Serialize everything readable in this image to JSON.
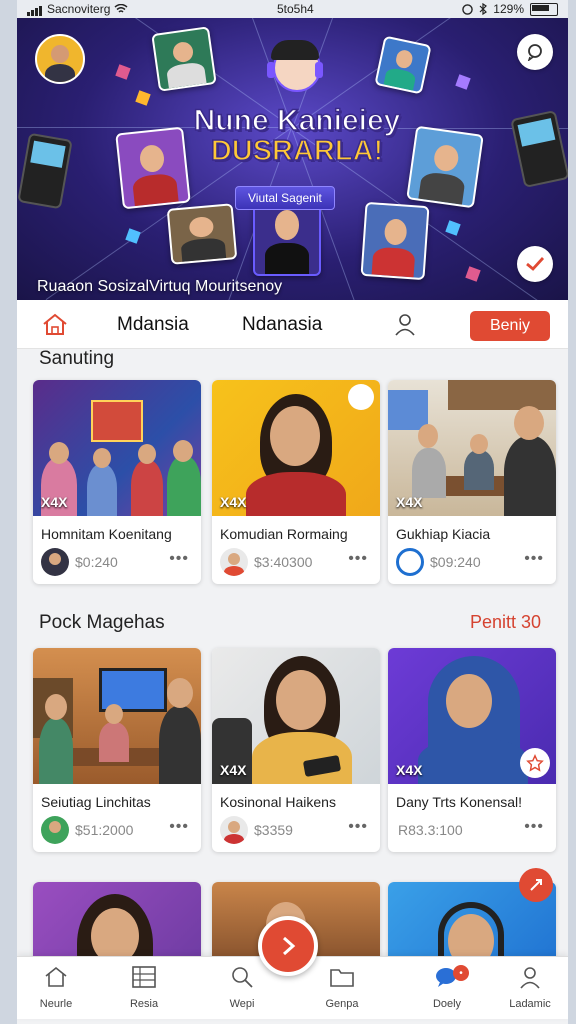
{
  "status_bar": {
    "carrier": "Sacnoviterg",
    "time": "5to5h4",
    "battery": "129%"
  },
  "hero": {
    "title_line1": "Nune Kanieiey",
    "title_line2": "DUSRARLA!",
    "pill": "Viutal Sagenit",
    "caption": "Ruaaon SosizalVirtuq Mouritsenoy"
  },
  "navbar": {
    "tab1": "Mdansia",
    "tab2": "Ndanasia",
    "button": "Beniy"
  },
  "section1": {
    "title": "Sanuting",
    "cards": [
      {
        "title": "Homnitam Koenitang",
        "price": "$0:240",
        "tag": "X4X"
      },
      {
        "title": "Komudian Rormaing",
        "price": "$3:40300",
        "tag": "X4X"
      },
      {
        "title": "Gukhiap Kiacia",
        "price": "$09:240",
        "tag": "X4X"
      }
    ]
  },
  "section2": {
    "title": "Pock Magehas",
    "link": "Penitt 30",
    "cards": [
      {
        "title": "Seiutiag Linchitas",
        "price": "$51:2000",
        "tag": ""
      },
      {
        "title": "Kosinonal Haikens",
        "price": "$3359",
        "tag": "X4X"
      },
      {
        "title": "Dany Trts Konensal!",
        "price": "R83.3:100",
        "tag": "X4X"
      }
    ]
  },
  "tabbar": {
    "items": [
      {
        "label": "Neurle",
        "icon": "home-icon"
      },
      {
        "label": "Resia",
        "icon": "grid-icon"
      },
      {
        "label": "Wepi",
        "icon": "search-icon"
      },
      {
        "label": "Genpa",
        "icon": "folder-icon"
      },
      {
        "label": "Doely",
        "icon": "chat-icon"
      },
      {
        "label": "Ladamic",
        "icon": "person-icon"
      }
    ]
  },
  "colors": {
    "accent": "#e04a33",
    "hero_bg": "#2a1f72",
    "title_yellow": "#ffc837"
  }
}
